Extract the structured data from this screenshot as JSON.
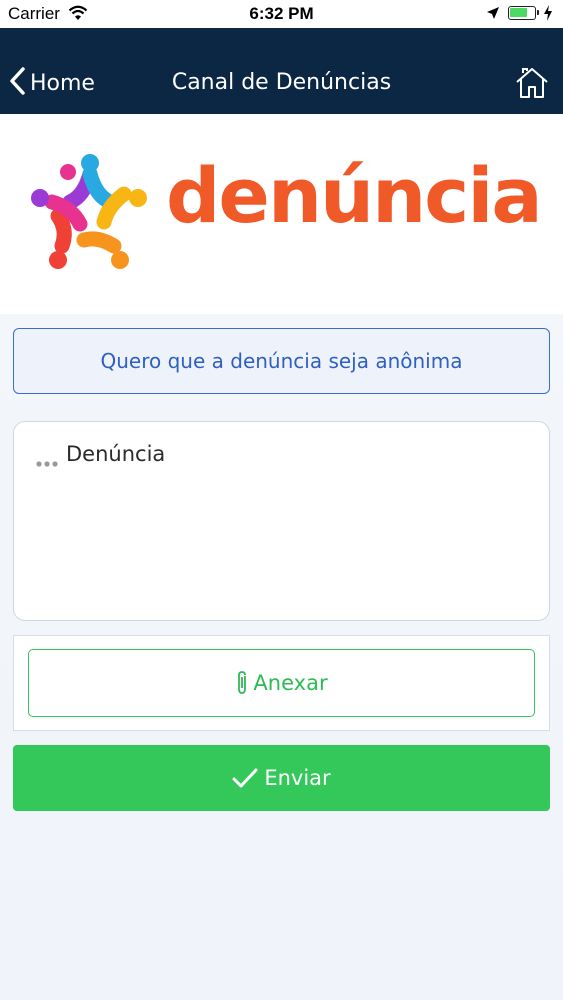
{
  "status_bar": {
    "carrier": "Carrier",
    "time": "6:32 PM",
    "icons": [
      "wifi-icon",
      "location-arrow-icon",
      "battery-icon",
      "charging-bolt-icon"
    ]
  },
  "nav": {
    "back_label": "Home",
    "title": "Canal de Denúncias",
    "icons": [
      "chevron-left-icon",
      "home-icon"
    ],
    "background": "#0b2744"
  },
  "logo": {
    "text": "denúncia",
    "color": "#f05a28"
  },
  "form": {
    "anonymous_label": "Quero que a denúncia seja anônima",
    "report_placeholder": "Denúncia",
    "attach_label": "Anexar",
    "send_label": "Enviar",
    "icons": [
      "ellipsis-icon",
      "paperclip-icon",
      "checkmark-icon"
    ],
    "accent_blue": "#3a6fd0",
    "accent_green": "#34c759"
  }
}
